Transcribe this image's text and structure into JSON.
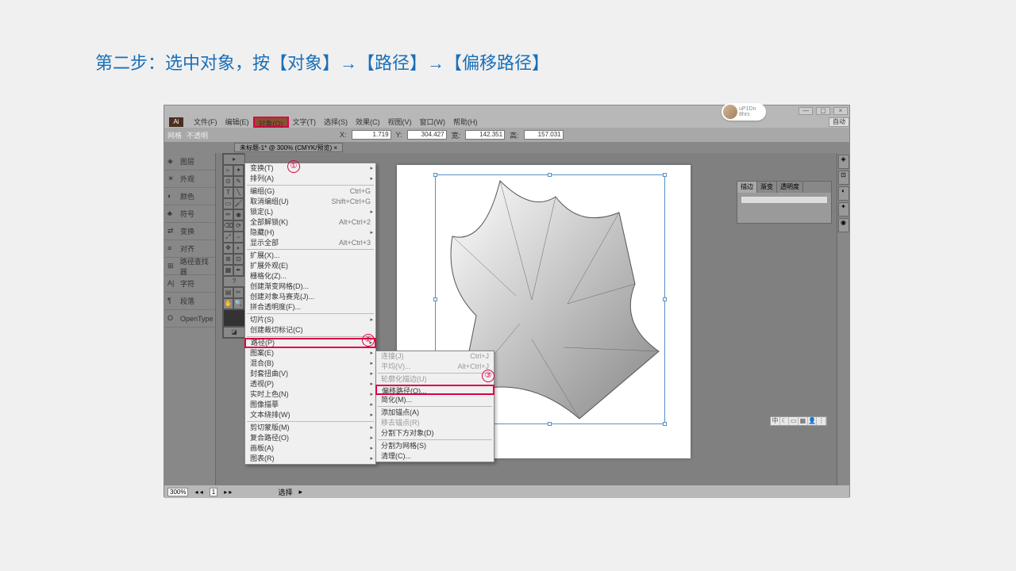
{
  "caption": "第二步：选中对象，按【对象】→【路径】→【偏移路径】",
  "menubar": {
    "items": [
      "文件(F)",
      "编辑(E)",
      "对象(O)",
      "文字(T)",
      "选择(S)",
      "效果(C)",
      "视图(V)",
      "窗口(W)",
      "帮助(H)"
    ]
  },
  "control": {
    "wanggeLabel": "网格",
    "butoumingLabel": "不透明",
    "xLabel": "X:",
    "xVal": "1.719",
    "yLabel": "Y:",
    "yVal": "304.427",
    "kuanLabel": "宽:",
    "kuanVal": "142.351",
    "gaoLabel": "高:",
    "gaoVal": "157.031",
    "autoLabel": "自动"
  },
  "tabbar": {
    "tab": "未标题-1* @ 300% (CMYK/预览) ×"
  },
  "leftPanel": {
    "items": [
      "图层",
      "外观",
      "颜色",
      "符号",
      "变换",
      "对齐",
      "路径查找器",
      "字符",
      "段落",
      "OpenType"
    ]
  },
  "dropdown": {
    "items": [
      {
        "l": "变换(T)",
        "sub": true
      },
      {
        "l": "排列(A)",
        "sub": true
      },
      "sep",
      {
        "l": "编组(G)",
        "s": "Ctrl+G"
      },
      {
        "l": "取消编组(U)",
        "s": "Shift+Ctrl+G"
      },
      {
        "l": "锁定(L)",
        "sub": true
      },
      {
        "l": "全部解锁(K)",
        "s": "Alt+Ctrl+2"
      },
      {
        "l": "隐藏(H)",
        "sub": true
      },
      {
        "l": "显示全部",
        "s": "Alt+Ctrl+3"
      },
      "sep",
      {
        "l": "扩展(X)..."
      },
      {
        "l": "扩展外观(E)"
      },
      {
        "l": "栅格化(Z)..."
      },
      {
        "l": "创建渐变网格(D)..."
      },
      {
        "l": "创建对象马赛克(J)..."
      },
      {
        "l": "拼合透明度(F)..."
      },
      "sep",
      {
        "l": "切片(S)",
        "sub": true
      },
      {
        "l": "创建裁切标记(C)"
      },
      "sep",
      {
        "l": "路径(P)",
        "sub": true,
        "box": true
      },
      {
        "l": "图案(E)",
        "sub": true
      },
      {
        "l": "混合(B)",
        "sub": true
      },
      {
        "l": "封套扭曲(V)",
        "sub": true
      },
      {
        "l": "透视(P)",
        "sub": true
      },
      {
        "l": "实时上色(N)",
        "sub": true
      },
      {
        "l": "图像描摹",
        "sub": true
      },
      {
        "l": "文本绕排(W)",
        "sub": true
      },
      "sep",
      {
        "l": "剪切蒙版(M)",
        "sub": true
      },
      {
        "l": "复合路径(O)",
        "sub": true
      },
      {
        "l": "画板(A)",
        "sub": true
      },
      {
        "l": "图表(R)",
        "sub": true
      }
    ]
  },
  "submenu": {
    "items": [
      {
        "l": "连接(J)",
        "s": "Ctrl+J",
        "dim": true
      },
      {
        "l": "平均(V)...",
        "s": "Alt+Ctrl+J",
        "dim": true
      },
      "sep",
      {
        "l": "轮廓化描边(U)",
        "dim": true
      },
      {
        "l": "偏移路径(O)...",
        "box": true
      },
      {
        "l": "简化(M)..."
      },
      "sep",
      {
        "l": "添加锚点(A)"
      },
      {
        "l": "移去锚点(R)",
        "dim": true
      },
      {
        "l": "分割下方对象(D)"
      },
      "sep",
      {
        "l": "分割为网格(S)"
      },
      {
        "l": "清理(C)..."
      }
    ]
  },
  "floatPanel": {
    "tabs": [
      "描边",
      "渐变",
      "透明度"
    ]
  },
  "circles": {
    "c1": "①",
    "c2": "②",
    "c3": "③"
  },
  "status": {
    "zoom": "300%",
    "page": "1",
    "navLabel": "选择",
    "t": "▸"
  },
  "userPill": {
    "name": "uP1Dn",
    "sub": "8hrs"
  },
  "miniTb": [
    "中",
    "",
    "",
    "",
    "",
    ""
  ]
}
